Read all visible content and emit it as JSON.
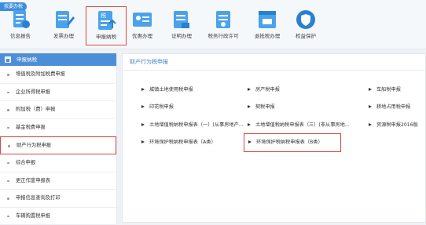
{
  "topbar": {
    "badge": "我要办税",
    "items": [
      {
        "label": "信息报告",
        "icon": "info-report-icon"
      },
      {
        "label": "发票办理",
        "icon": "invoice-icon"
      },
      {
        "label": "申报纳税",
        "icon": "tax-declare-icon",
        "active": true
      },
      {
        "label": "优惠办理",
        "icon": "preferential-icon"
      },
      {
        "label": "证明办理",
        "icon": "certificate-icon"
      },
      {
        "label": "税务行政许可",
        "icon": "permit-icon"
      },
      {
        "label": "退抵税办理",
        "icon": "refund-icon"
      },
      {
        "label": "权益保护",
        "icon": "rights-protect-icon"
      }
    ]
  },
  "sidebar": {
    "header": "申报纳税",
    "items": [
      {
        "label": "增值税及附加税费申报"
      },
      {
        "label": "企业所得税申报"
      },
      {
        "label": "附加税（费）申报"
      },
      {
        "label": "基金税费申报"
      },
      {
        "label": "财产行为税申报",
        "active": true
      },
      {
        "label": "综合申报"
      },
      {
        "label": "更正作废申报表"
      },
      {
        "label": "申报信息查询及打印"
      },
      {
        "label": "车辆购置税申报"
      }
    ]
  },
  "main": {
    "title": "财产行为税申报",
    "rows": [
      [
        "城镇土地使用税申报",
        "房产税申报",
        "车船税申报"
      ],
      [
        "印花税申报",
        "契税申报",
        "耕地占用税申报"
      ],
      [
        "土地增值税纳税申报表（一）(从事房地产...",
        "土地增值税纳税申报表（三）(非从事房地...",
        "资源税申报2016版"
      ],
      [
        "环境保护税纳税申报表（A类）",
        "环境保护税纳税申报表（B类）",
        ""
      ]
    ],
    "active_cell": "环境保护税纳税申报表（B类）"
  },
  "colors": {
    "accent": "#4d8fd6",
    "highlight": "#e0453c"
  }
}
